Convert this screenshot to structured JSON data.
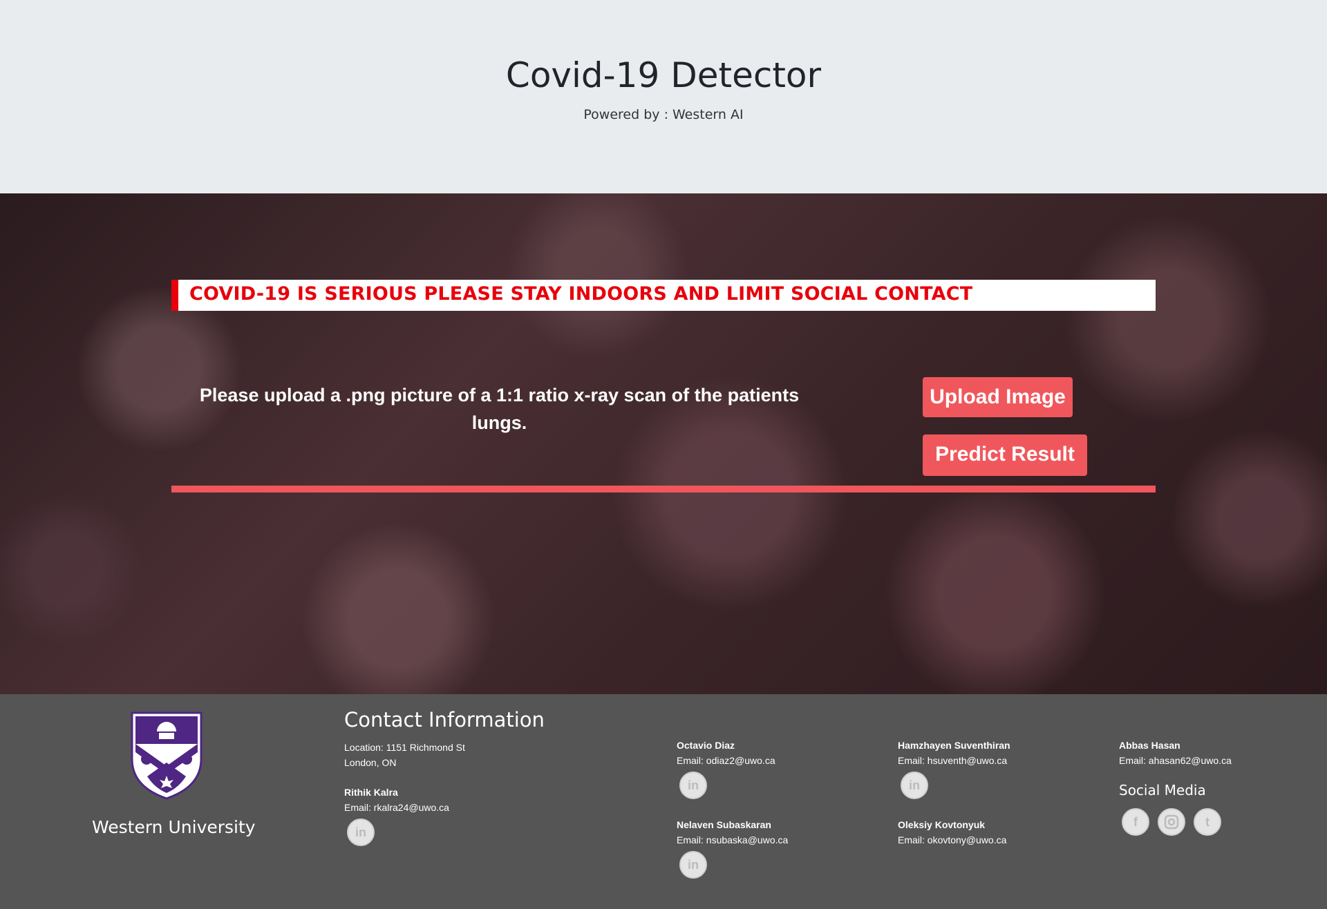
{
  "header": {
    "title": "Covid-19 Detector",
    "subtitle": "Powered by : Western AI"
  },
  "hero": {
    "banner": "COVID-19 IS SERIOUS PLEASE STAY INDOORS AND LIMIT SOCIAL CONTACT",
    "instructions": "Please upload a .png picture of a 1:1 ratio x-ray scan of the patients lungs.",
    "upload_label": "Upload Image",
    "predict_label": "Predict Result"
  },
  "footer": {
    "university": "Western University",
    "contact_title": "Contact Information",
    "location_line1": "Location: 1151 Richmond St",
    "location_line2": "London, ON",
    "linkedin_glyph": "in",
    "contacts": [
      {
        "name": "Rithik Kalra",
        "email": "Email: rkalra24@uwo.ca"
      },
      {
        "name": "Octavio Diaz",
        "email": "Email: odiaz2@uwo.ca"
      },
      {
        "name": "Nelaven Subaskaran",
        "email": "Email: nsubaska@uwo.ca"
      },
      {
        "name": "Hamzhayen Suventhiran",
        "email": "Email: hsuventh@uwo.ca"
      },
      {
        "name": "Oleksiy Kovtonyuk",
        "email": "Email: okovtony@uwo.ca"
      },
      {
        "name": "Abbas Hasan",
        "email": "Email: ahasan62@uwo.ca"
      }
    ],
    "social_title": "Social Media",
    "social": {
      "facebook": "f",
      "twitter": "t"
    }
  },
  "colors": {
    "accent": "#f0575c",
    "banner_red": "#e8000b",
    "footer_bg": "#555555",
    "header_bg": "#e9ecef",
    "western_purple": "#4f2683"
  },
  "icons": [
    "western-shield-logo",
    "linkedin-icon",
    "facebook-icon",
    "instagram-icon",
    "twitter-icon"
  ]
}
